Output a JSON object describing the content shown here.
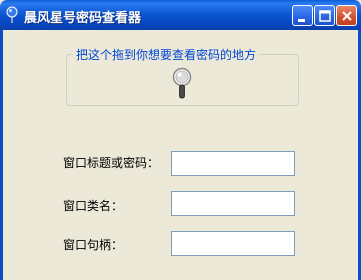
{
  "window": {
    "title": "晨风星号密码查看器",
    "icon": "pin-icon"
  },
  "titlebar_buttons": {
    "minimize": "minimize-icon",
    "maximize": "maximize-icon",
    "close": "close-icon"
  },
  "finder_group": {
    "legend": "把这个拖到你想要查看密码的地方",
    "icon": "magnifier-icon"
  },
  "fields": {
    "title_or_password": {
      "label": "窗口标题或密码：",
      "value": ""
    },
    "class_name": {
      "label": "窗口类名：",
      "value": ""
    },
    "handle": {
      "label": "窗口句柄：",
      "value": ""
    }
  },
  "colors": {
    "titlebar": "#0a5fd8",
    "legend_text": "#0046d5",
    "dialog_bg": "#ece9d8"
  }
}
